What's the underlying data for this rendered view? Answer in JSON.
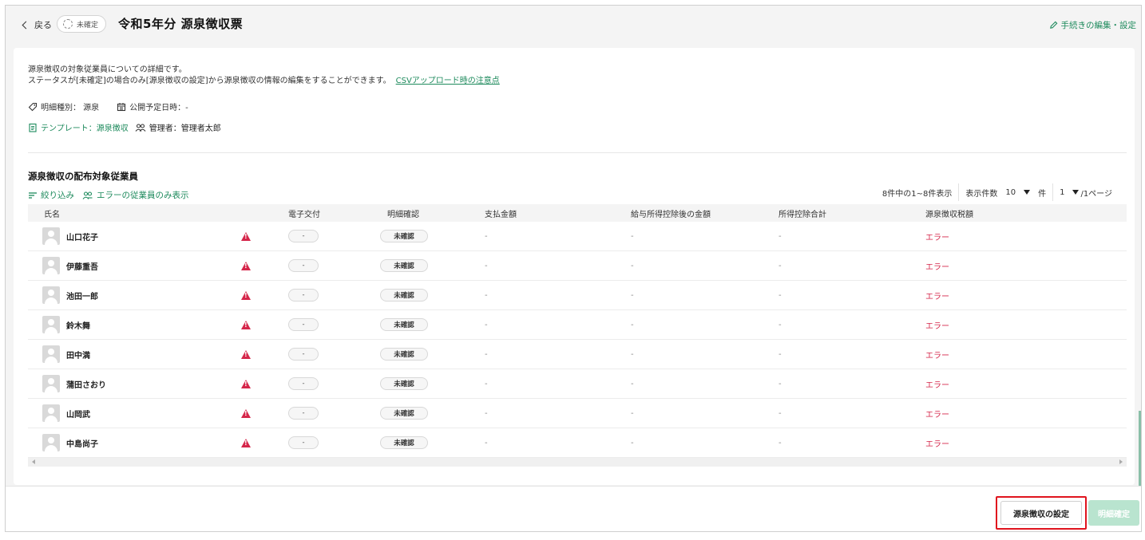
{
  "header": {
    "back_label": "戻る",
    "status": "未確定",
    "title": "令和5年分 源泉徴収票",
    "edit_label": "手続きの編集・設定"
  },
  "info": {
    "line1": "源泉徴収の対象従業員についての詳細です。",
    "line2": "ステータスが[未確定]の場合のみ[源泉徴収の設定]から源泉徴収の情報の編集をすることができます。",
    "csv_link": "CSVアップロード時の注意点",
    "detail_type": "明細種別： 源泉",
    "publish_date": "公開予定日時：-",
    "template": "テンプレート：源泉徴収",
    "manager": "管理者：管理者太郎"
  },
  "section": {
    "title": "源泉徴収の配布対象従業員",
    "filter_label": "絞り込み",
    "error_only_label": "エラーの従業員のみ表示"
  },
  "pager": {
    "summary": "8件中の1~8件表示",
    "per_page_label": "表示件数",
    "per_page_value": "10",
    "per_page_unit": "件",
    "page_value": "1",
    "page_suffix": "/1ページ"
  },
  "table": {
    "headers": [
      "氏名",
      "電子交付",
      "明細確認",
      "支払金額",
      "給与所得控除後の金額",
      "所得控除合計",
      "源泉徴収税額"
    ],
    "rows": [
      {
        "name": "山口花子",
        "delivery": "-",
        "confirm": "未確認",
        "pay": "-",
        "after": "-",
        "deduct": "-",
        "tax": "エラー"
      },
      {
        "name": "伊藤重吾",
        "delivery": "-",
        "confirm": "未確認",
        "pay": "-",
        "after": "-",
        "deduct": "-",
        "tax": "エラー"
      },
      {
        "name": "池田一郎",
        "delivery": "-",
        "confirm": "未確認",
        "pay": "-",
        "after": "-",
        "deduct": "-",
        "tax": "エラー"
      },
      {
        "name": "鈴木舞",
        "delivery": "-",
        "confirm": "未確認",
        "pay": "-",
        "after": "-",
        "deduct": "-",
        "tax": "エラー"
      },
      {
        "name": "田中満",
        "delivery": "-",
        "confirm": "未確認",
        "pay": "-",
        "after": "-",
        "deduct": "-",
        "tax": "エラー"
      },
      {
        "name": "蒲田さおり",
        "delivery": "-",
        "confirm": "未確認",
        "pay": "-",
        "after": "-",
        "deduct": "-",
        "tax": "エラー"
      },
      {
        "name": "山岡武",
        "delivery": "-",
        "confirm": "未確認",
        "pay": "-",
        "after": "-",
        "deduct": "-",
        "tax": "エラー"
      },
      {
        "name": "中島尚子",
        "delivery": "-",
        "confirm": "未確認",
        "pay": "-",
        "after": "-",
        "deduct": "-",
        "tax": "エラー"
      }
    ]
  },
  "footer": {
    "settings_button": "源泉徴収の設定",
    "confirm_button": "明細確定"
  },
  "colors": {
    "accent": "#1d8a5c",
    "error": "#d5264a",
    "highlight": "#e0141e"
  },
  "icons": [
    "chevron-left-icon",
    "pending-circle-icon",
    "pencil-icon",
    "tag-icon",
    "calendar-icon",
    "document-icon",
    "users-icon",
    "filter-icon",
    "user-error-icon",
    "caret-down-icon",
    "avatar-icon",
    "warning-icon"
  ]
}
